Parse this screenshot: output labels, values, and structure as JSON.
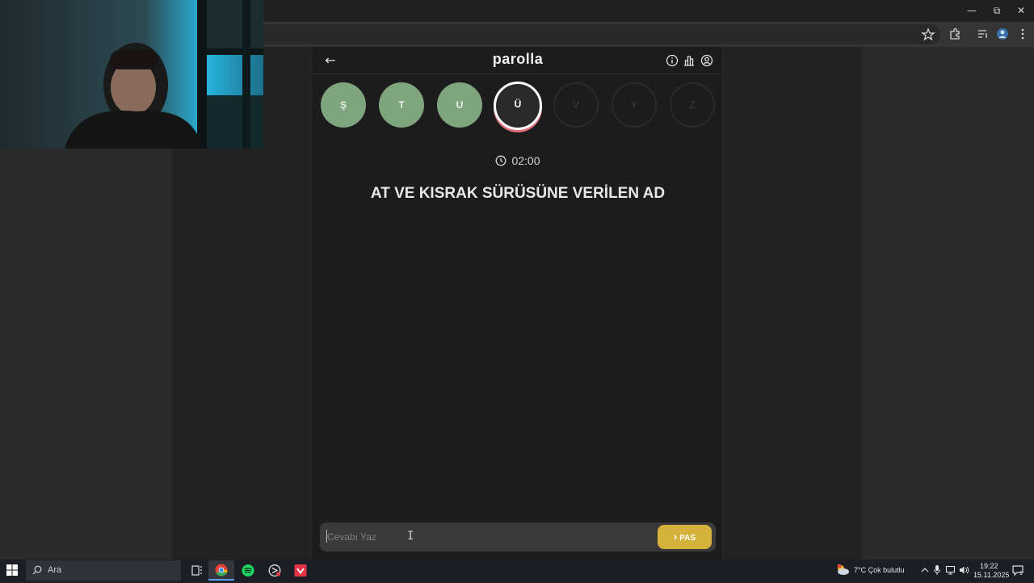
{
  "window": {
    "minimize_glyph": "—",
    "restore_glyph": "⧉",
    "close_glyph": "✕"
  },
  "toolbar": {
    "icons": [
      "star-icon",
      "extensions-icon",
      "media-icon",
      "profile-icon",
      "menu-icon"
    ]
  },
  "game": {
    "back_icon": "←",
    "title": "parolla",
    "header_icons": [
      "info-icon",
      "stats-icon",
      "account-icon"
    ],
    "letters": [
      {
        "letter": "Ş",
        "state": "done"
      },
      {
        "letter": "T",
        "state": "done"
      },
      {
        "letter": "U",
        "state": "done"
      },
      {
        "letter": "Ü",
        "state": "active"
      },
      {
        "letter": "V",
        "state": "pending"
      },
      {
        "letter": "Y",
        "state": "pending"
      },
      {
        "letter": "Z",
        "state": "pending"
      }
    ],
    "timer": "02:00",
    "question": "AT VE KISRAK SÜRÜSÜNE VERİLEN AD",
    "answer_placeholder": "Cevabı Yaz",
    "pass_label": "PAS",
    "pass_icon": "›"
  },
  "taskbar": {
    "search_label": "Ara",
    "weather": "7°C  Çok bulutlu",
    "time": "19:22",
    "date": "15.11.2025",
    "notification_count": "1"
  }
}
